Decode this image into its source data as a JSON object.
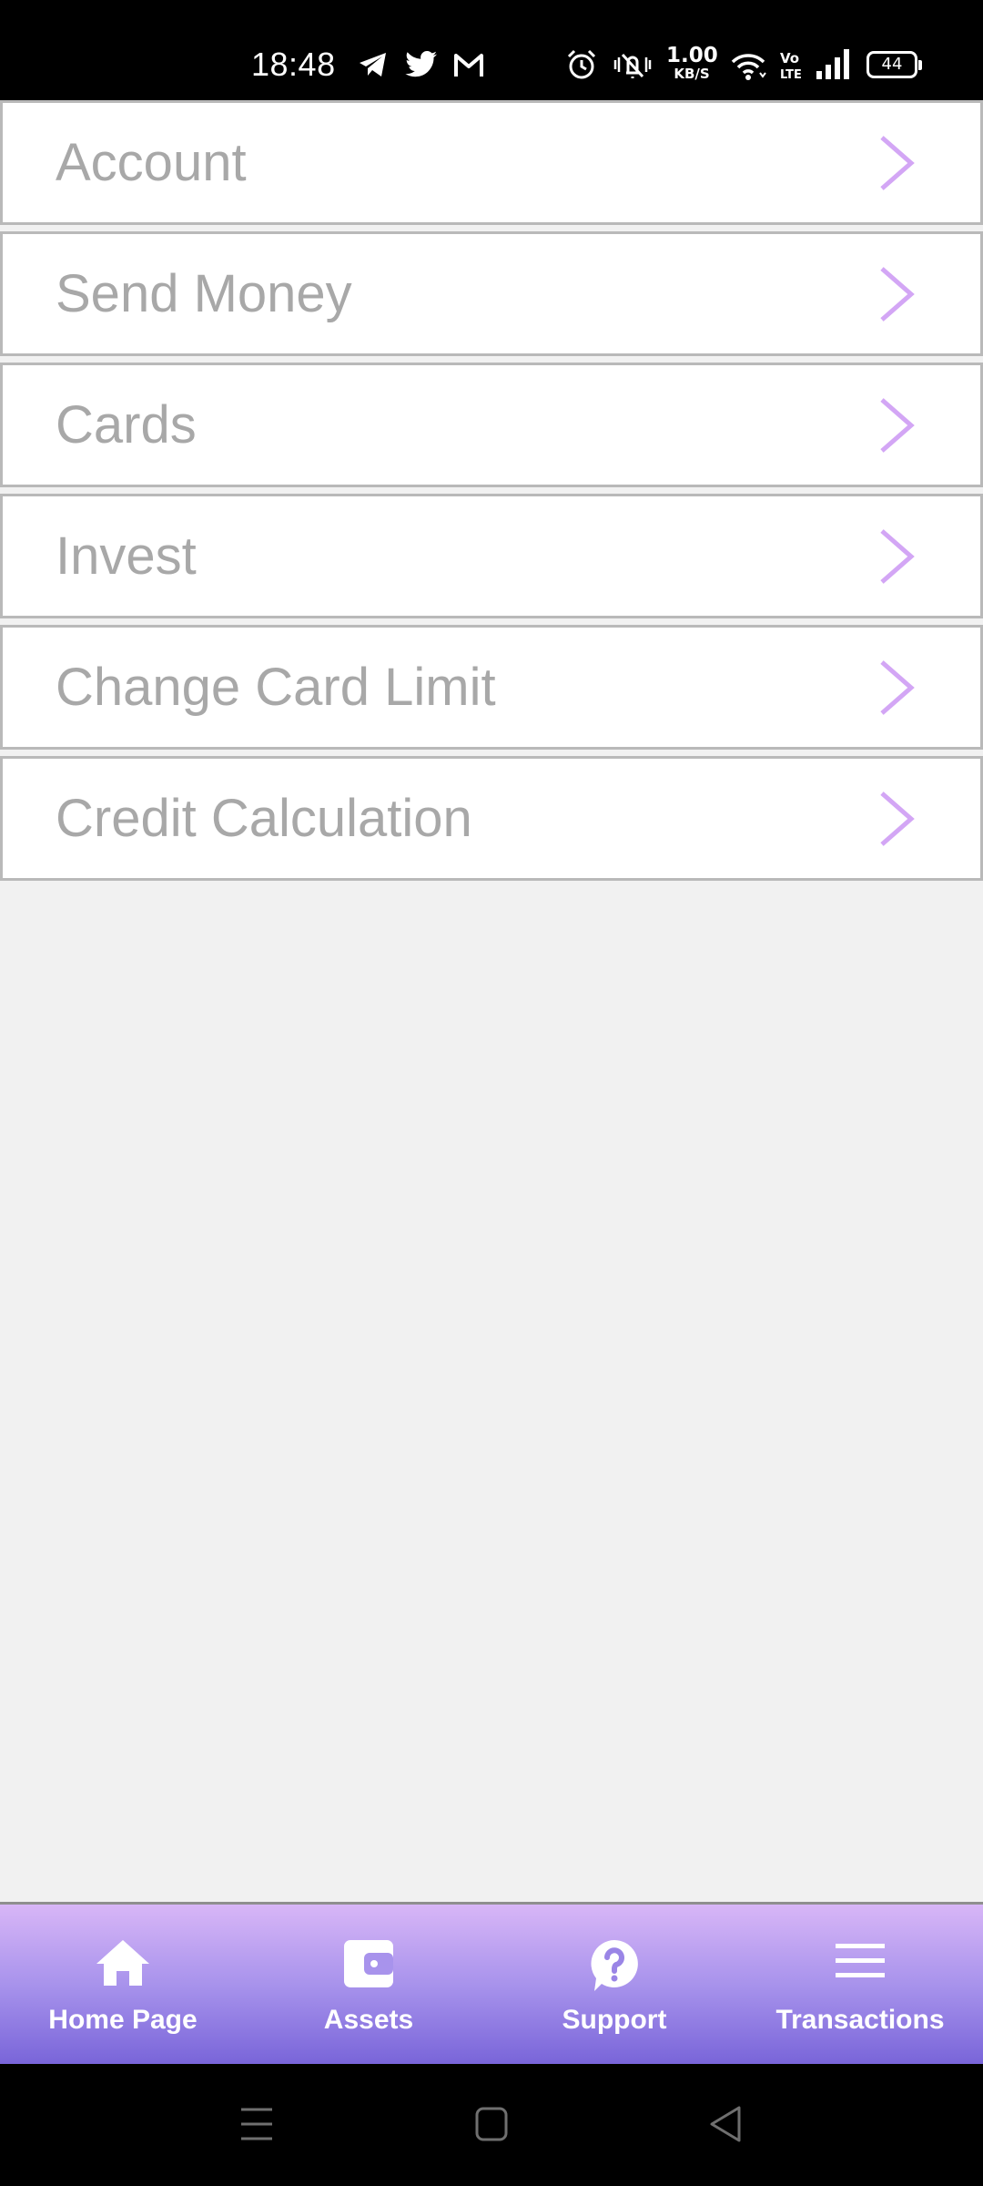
{
  "status_bar": {
    "time": "18:48",
    "net_speed_value": "1.00",
    "net_speed_unit": "KB/S",
    "battery_level": "44",
    "icons": [
      "telegram-icon",
      "twitter-icon",
      "gmail-icon",
      "alarm-icon",
      "vibrate-icon",
      "wifi-icon",
      "volte-icon",
      "signal-icon",
      "battery-icon"
    ]
  },
  "menu": {
    "items": [
      {
        "label": "Account"
      },
      {
        "label": "Send Money"
      },
      {
        "label": "Cards"
      },
      {
        "label": "Invest"
      },
      {
        "label": "Change Card Limit"
      },
      {
        "label": "Credit Calculation"
      }
    ],
    "chevron_color": "#d3a6f5",
    "label_color": "#a8a8a8"
  },
  "bottom_nav": {
    "items": [
      {
        "label": "Home Page",
        "icon": "home-icon"
      },
      {
        "label": "Assets",
        "icon": "wallet-icon"
      },
      {
        "label": "Support",
        "icon": "question-icon"
      },
      {
        "label": "Transactions",
        "icon": "menu-lines-icon"
      }
    ],
    "gradient_top": "#d8b6f7",
    "gradient_bottom": "#7965d9"
  },
  "system_nav": {
    "icons": [
      "recent-apps-icon",
      "home-button-icon",
      "back-icon"
    ]
  }
}
